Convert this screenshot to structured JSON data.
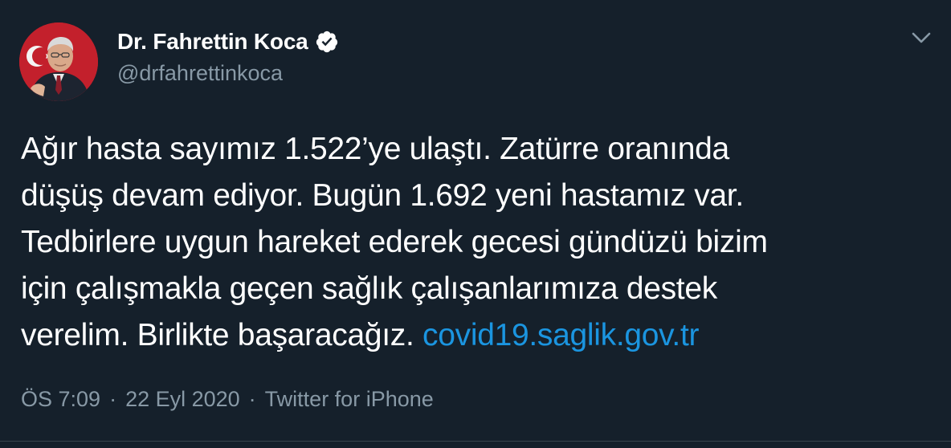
{
  "author": {
    "name": "Dr. Fahrettin Koca",
    "handle": "@drfahrettinkoca",
    "verified": true,
    "avatar": "avatar-photo"
  },
  "menu": {
    "icon": "chevron-down-icon"
  },
  "tweet": {
    "lines": [
      "Ağır hasta sayımız 1.522’ye ulaştı. Zatürre oranında",
      "düşüş devam ediyor. Bugün 1.692 yeni hastamız var.",
      "Tedbirlere uygun hareket ederek gecesi gündüzü bizim",
      "için çalışmakla geçen sağlık çalışanlarımıza destek",
      "verelim. Birlikte başaracağız. "
    ],
    "link_text": "covid19.saglik.gov.tr"
  },
  "meta": {
    "time": "ÖS 7:09",
    "separator": "·",
    "date": "22 Eyl 2020",
    "source": "Twitter for iPhone"
  },
  "colors": {
    "background": "#15202b",
    "text": "#ffffff",
    "secondary": "#8899a6",
    "link": "#1b95e0",
    "verified_badge": "#ffffff"
  }
}
